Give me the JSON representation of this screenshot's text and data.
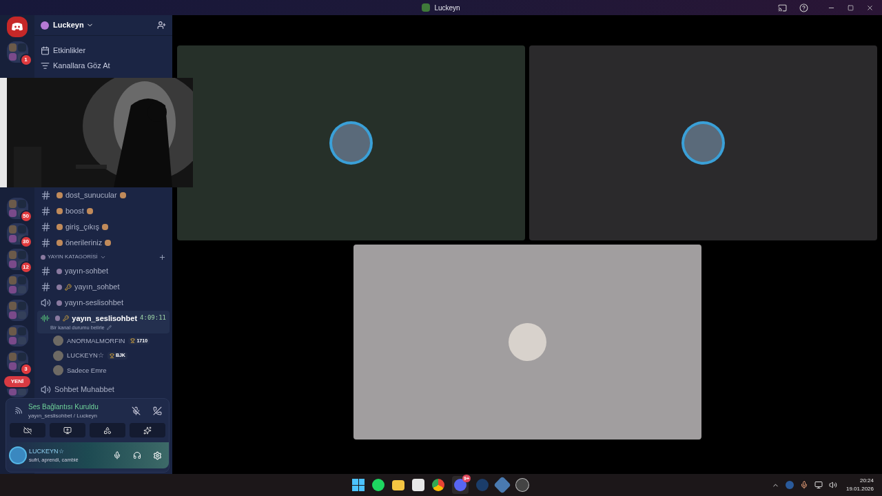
{
  "title_bar": {
    "title": "Luckeyn"
  },
  "servers_above": [
    {
      "kind": "badged",
      "badge": "1"
    }
  ],
  "servers_below": [
    {
      "kind": "badged",
      "badge": "50"
    },
    {
      "kind": "badged",
      "badge": "30"
    },
    {
      "kind": "badged",
      "badge": "12"
    },
    {
      "kind": "plain"
    },
    {
      "kind": "plain"
    },
    {
      "kind": "plain"
    },
    {
      "kind": "badged",
      "badge": "3"
    },
    {
      "kind": "new",
      "badge": "YENİ"
    }
  ],
  "server_header": {
    "name": "Luckeyn"
  },
  "menu": [
    {
      "kind": "events",
      "label": "Etkinlikler"
    },
    {
      "kind": "browse",
      "label": "Kanallara Göz At"
    }
  ],
  "channels": [
    {
      "kind": "text",
      "name": "dost_sunucular"
    },
    {
      "kind": "text",
      "name": "boost"
    },
    {
      "kind": "text",
      "name": "giriş_çıkış"
    },
    {
      "kind": "text",
      "name": "önerileriniz"
    }
  ],
  "category": {
    "name": "YAYIN KATAGORİSİ"
  },
  "category_channels": [
    {
      "kind": "text",
      "name": "yayın-sohbet",
      "key": false,
      "selected": false
    },
    {
      "kind": "text",
      "name": "yayın_sohbet",
      "key": true,
      "selected": false
    },
    {
      "kind": "voice",
      "name": "yayın-seslisohbet",
      "key": false,
      "selected": false
    },
    {
      "kind": "voice",
      "name": "yayın_seslisohbet",
      "key": true,
      "selected": true,
      "timer": "4:09:11",
      "status": "Bir kanal durumu belirle"
    }
  ],
  "voice_users": [
    {
      "name": "ANORMALMORFIN",
      "tag": "1710"
    },
    {
      "name": "LUCKEYN☆",
      "tag": "BJK"
    },
    {
      "name": "Sadece Emre"
    }
  ],
  "after_channels": [
    {
      "kind": "voice",
      "name": "Sohbet Muhabbet"
    }
  ],
  "voice_panel": {
    "status": "Ses Bağlantısı Kuruldu",
    "location": "yayın_seslisohbet / Luckeyn"
  },
  "user": {
    "name": "LUCKEYN☆",
    "activity": "sufri, aprendi, cambié"
  },
  "tiles": [
    {
      "color": "#263029"
    },
    {
      "color": "#2b2a2c"
    },
    {
      "color": "#a19e9f"
    }
  ],
  "taskbar": {
    "discord_badge": "9+",
    "time": "20:24",
    "date": "19.01.2026"
  }
}
